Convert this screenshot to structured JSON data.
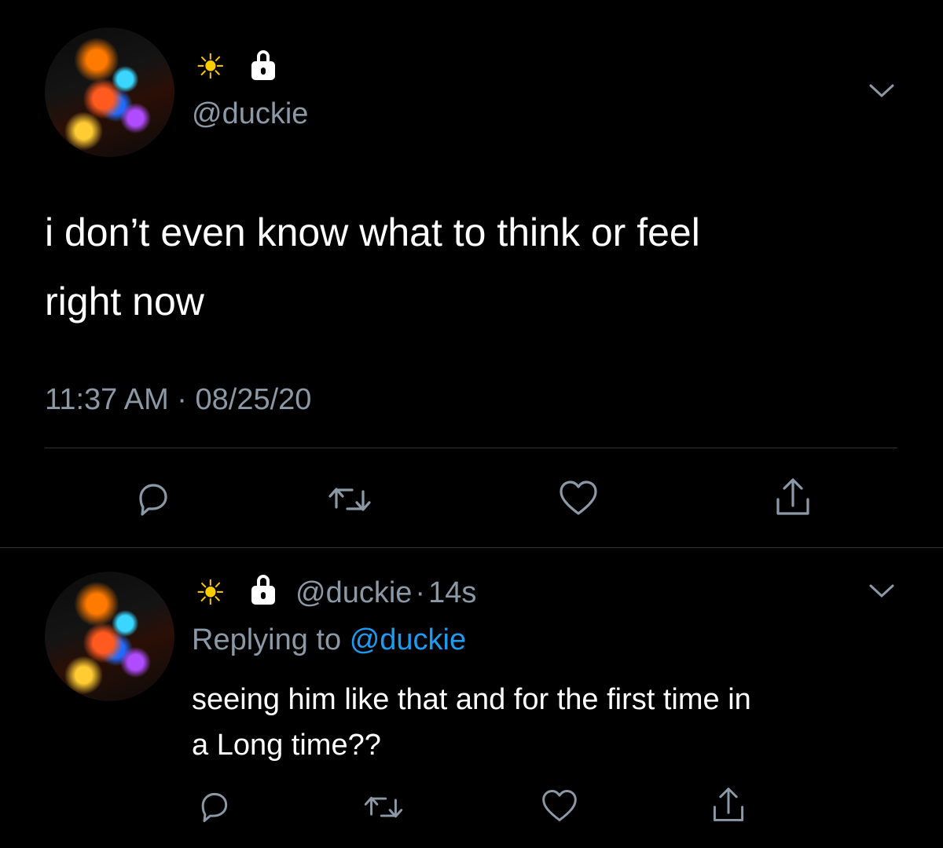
{
  "main_tweet": {
    "handle": "@duckie",
    "text_line1": "i don’t even know what to think or feel",
    "text_line2": "right now",
    "timestamp": "11:37 AM · 08/25/20",
    "name_icons": [
      "sun-icon",
      "lock-icon"
    ]
  },
  "reply_tweet": {
    "handle": "@duckie",
    "separator": "·",
    "age": "14s",
    "replying_prefix": "Replying to",
    "replying_handle": "@duckie",
    "text_line1": "seeing him like that and for the first time in",
    "text_line2": "a Long time??",
    "name_icons": [
      "sun-icon",
      "lock-icon"
    ]
  },
  "actions": [
    "reply-icon",
    "retweet-icon",
    "like-icon",
    "share-icon"
  ],
  "colors": {
    "background": "#000000",
    "text": "#ffffff",
    "secondary_text": "#8b98a5",
    "link": "#1d9bf0",
    "divider": "#2f3336"
  }
}
